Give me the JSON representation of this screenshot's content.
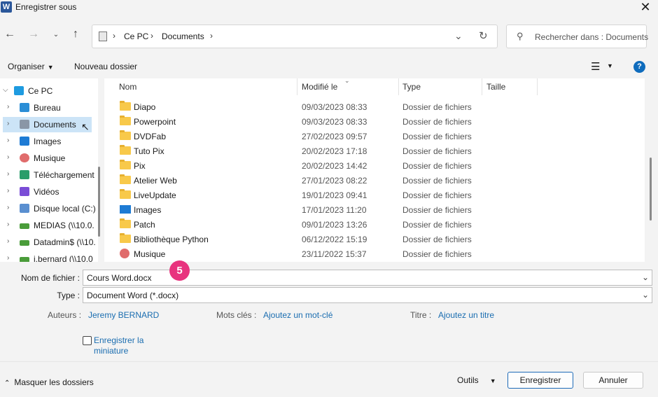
{
  "window": {
    "app_icon": "W",
    "title": "Enregistrer sous",
    "close_icon": "✕"
  },
  "address_bar": {
    "crumbs": [
      "Ce PC",
      "Documents"
    ],
    "separator": "›"
  },
  "search": {
    "placeholder": "Rechercher dans : Documents"
  },
  "toolbar": {
    "organize": "Organiser",
    "new_folder": "Nouveau dossier"
  },
  "nav_pane": {
    "items": [
      {
        "label": "Ce PC",
        "icon": "pc-icon",
        "color": "#1e9be0",
        "expanded": true
      },
      {
        "label": "Bureau",
        "icon": "desktop-icon",
        "color": "#2b8ed6"
      },
      {
        "label": "Documents",
        "icon": "documents-icon",
        "color": "#8a96a6",
        "selected": true
      },
      {
        "label": "Images",
        "icon": "images-icon",
        "color": "#1e7bd4"
      },
      {
        "label": "Musique",
        "icon": "music-icon",
        "color": "#e06c6c"
      },
      {
        "label": "Téléchargement",
        "icon": "download-icon",
        "color": "#2a9d6a"
      },
      {
        "label": "Vidéos",
        "icon": "videos-icon",
        "color": "#7a4dd6"
      },
      {
        "label": "Disque local (C:)",
        "icon": "drive-icon",
        "color": "#5a8fd0"
      },
      {
        "label": "MEDIAS (\\\\10.0.",
        "icon": "network-drive-icon",
        "color": "#4a9c3a"
      },
      {
        "label": "Datadmin$ (\\\\10.",
        "icon": "network-drive-icon",
        "color": "#4a9c3a"
      },
      {
        "label": "j.bernard (\\\\10.0",
        "icon": "network-drive-icon",
        "color": "#4a9c3a"
      }
    ]
  },
  "file_list": {
    "columns": [
      "Nom",
      "Modifié le",
      "Type",
      "Taille"
    ],
    "rows": [
      {
        "name": "Diapo",
        "date": "09/03/2023 08:33",
        "type": "Dossier de fichiers",
        "icon": "folder"
      },
      {
        "name": "Powerpoint",
        "date": "09/03/2023 08:33",
        "type": "Dossier de fichiers",
        "icon": "folder"
      },
      {
        "name": "DVDFab",
        "date": "27/02/2023 09:57",
        "type": "Dossier de fichiers",
        "icon": "folder"
      },
      {
        "name": "Tuto Pix",
        "date": "20/02/2023 17:18",
        "type": "Dossier de fichiers",
        "icon": "folder"
      },
      {
        "name": "Pix",
        "date": "20/02/2023 14:42",
        "type": "Dossier de fichiers",
        "icon": "folder"
      },
      {
        "name": "Atelier Web",
        "date": "27/01/2023 08:22",
        "type": "Dossier de fichiers",
        "icon": "folder"
      },
      {
        "name": "LiveUpdate",
        "date": "19/01/2023 09:41",
        "type": "Dossier de fichiers",
        "icon": "folder"
      },
      {
        "name": "Images",
        "date": "17/01/2023 11:20",
        "type": "Dossier de fichiers",
        "icon": "images"
      },
      {
        "name": "Patch",
        "date": "09/01/2023 13:26",
        "type": "Dossier de fichiers",
        "icon": "folder"
      },
      {
        "name": "Bibliothèque Python",
        "date": "06/12/2022 15:19",
        "type": "Dossier de fichiers",
        "icon": "folder"
      },
      {
        "name": "Musique",
        "date": "23/11/2022 15:37",
        "type": "Dossier de fichiers",
        "icon": "music"
      }
    ]
  },
  "form": {
    "filename_label": "Nom de fichier :",
    "filename_value": "Cours Word.docx",
    "type_label": "Type :",
    "type_value": "Document Word (*.docx)",
    "step_badge": "5",
    "authors_label": "Auteurs :",
    "authors_value": "Jeremy BERNARD",
    "keywords_label": "Mots clés :",
    "keywords_value": "Ajoutez un mot-clé",
    "title_label": "Titre :",
    "title_value": "Ajoutez un titre",
    "thumbnail_label": "Enregistrer la miniature",
    "thumbnail_checked": false
  },
  "bottom": {
    "hide_folders": "Masquer les dossiers",
    "tools": "Outils",
    "save": "Enregistrer",
    "cancel": "Annuler"
  }
}
